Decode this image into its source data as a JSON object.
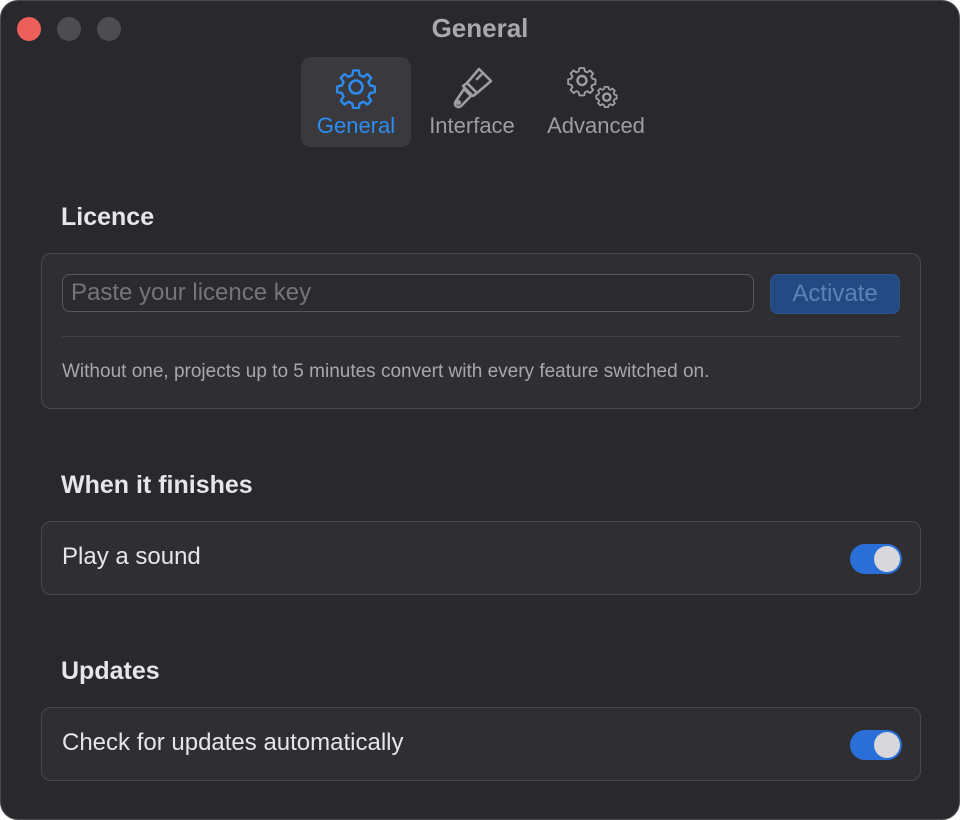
{
  "window": {
    "title": "General"
  },
  "tabs": [
    {
      "label": "General",
      "icon": "gear-icon",
      "active": true
    },
    {
      "label": "Interface",
      "icon": "paintbrush-icon",
      "active": false
    },
    {
      "label": "Advanced",
      "icon": "gears-icon",
      "active": false
    }
  ],
  "licence": {
    "title": "Licence",
    "input_placeholder": "Paste your licence key",
    "input_value": "",
    "activate_label": "Activate",
    "note": "Without one, projects up to 5 minutes convert with every feature switched on."
  },
  "finish": {
    "title": "When it finishes",
    "play_sound_label": "Play a sound",
    "play_sound_on": true
  },
  "updates": {
    "title": "Updates",
    "auto_check_label": "Check for updates automatically",
    "auto_check_on": true
  },
  "colors": {
    "accent": "#2a6fd7",
    "active_tab_text": "#2d8cf0",
    "close_button": "#ec5f5a"
  }
}
